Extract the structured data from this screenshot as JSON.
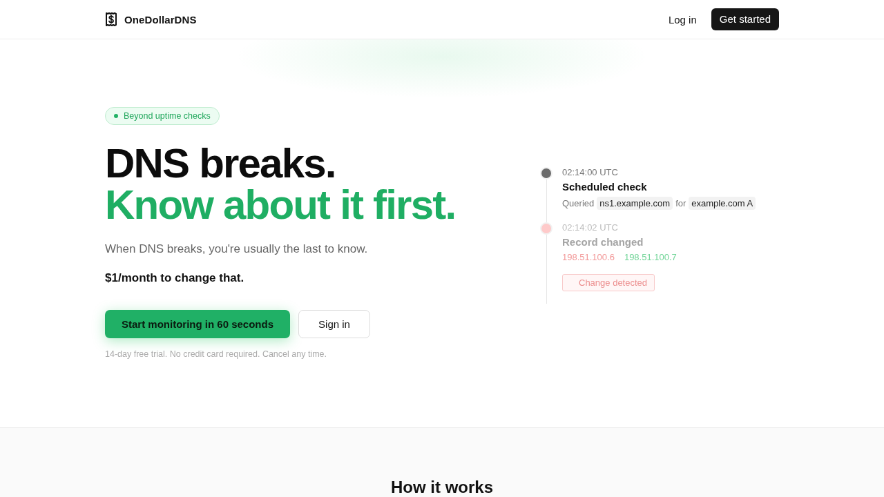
{
  "header": {
    "brand": "OneDollarDNS",
    "nav": [
      {
        "label": "Log in",
        "kind": "link"
      },
      {
        "label": "Get started",
        "kind": "primary"
      }
    ]
  },
  "hero": {
    "badge": "Beyond uptime checks",
    "headline": "DNS breaks.",
    "headline_accent": "Know about it first.",
    "lead": "When DNS breaks, you're usually the last to know.",
    "price_line": "$1/month to change that.",
    "buttons": [
      {
        "label": "Start monitoring in 60 seconds",
        "kind": "primary"
      },
      {
        "label": "Sign in",
        "kind": "secondary"
      }
    ],
    "note": "14-day free trial. No credit card required. Cancel any time."
  },
  "timeline": [
    {
      "time": "02:14:00 UTC",
      "title": "Scheduled check",
      "color": "#6b6b6b",
      "faded": false,
      "details": [
        {
          "kind": "text",
          "text": "Queried"
        },
        {
          "kind": "code",
          "text": "ns1.example.com"
        },
        {
          "kind": "text",
          "text": "for"
        },
        {
          "kind": "code",
          "text": "example.com A"
        }
      ]
    },
    {
      "time": "02:14:02 UTC",
      "title": "Record changed",
      "color": "#fecaca",
      "faded": true,
      "details": [
        {
          "kind": "old",
          "text": "198.51.100.6"
        },
        {
          "kind": "new",
          "text": "198.51.100.7"
        }
      ],
      "badge": "Change detected"
    }
  ],
  "section": {
    "title": "How it works"
  }
}
